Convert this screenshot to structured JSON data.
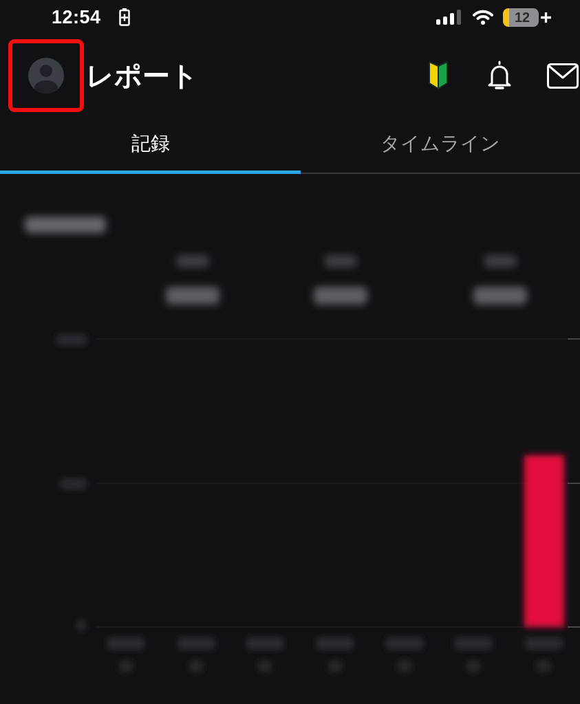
{
  "status_bar": {
    "time": "12:54",
    "battery": {
      "text": "12",
      "low_power": true,
      "charging": true
    }
  },
  "header": {
    "avatar": {
      "highlighted": true
    },
    "title": "レポート"
  },
  "tabs": [
    {
      "label": "記録",
      "selected": true
    },
    {
      "label": "タイムライン",
      "selected": false
    }
  ],
  "report": {
    "blurred": true
  }
}
